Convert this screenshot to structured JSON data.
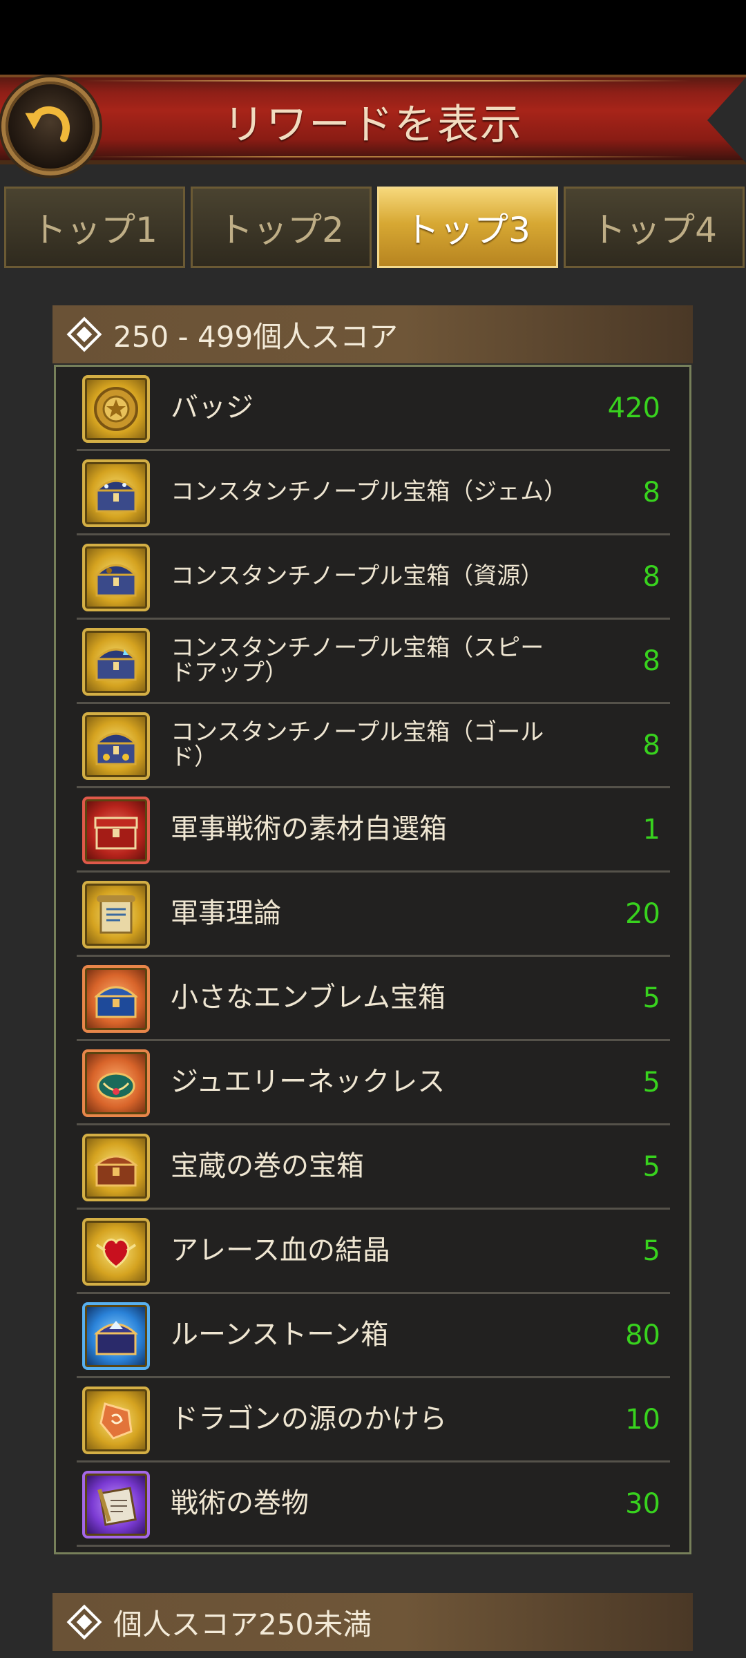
{
  "header": {
    "title": "リワードを表示"
  },
  "tabs": [
    {
      "label": "トップ1"
    },
    {
      "label": "トップ2"
    },
    {
      "label": "トップ3"
    },
    {
      "label": "トップ4"
    }
  ],
  "active_tab": "トップ3",
  "sections": [
    {
      "title": "250 - 499個人スコア",
      "items": [
        {
          "icon": "badge-icon",
          "name": "バッジ",
          "count": "420"
        },
        {
          "icon": "chest-icon",
          "name": "コンスタンチノープル宝箱（ジェム）",
          "count": "8"
        },
        {
          "icon": "chest-icon",
          "name": "コンスタンチノープル宝箱（資源）",
          "count": "8"
        },
        {
          "icon": "chest-icon",
          "name": "コンスタンチノープル宝箱（スピードアップ）",
          "count": "8"
        },
        {
          "icon": "chest-icon",
          "name": "コンスタンチノープル宝箱（ゴールド）",
          "count": "8"
        },
        {
          "icon": "red-chest-icon",
          "name": "軍事戦術の素材自選箱",
          "count": "1"
        },
        {
          "icon": "scroll-icon",
          "name": "軍事理論",
          "count": "20"
        },
        {
          "icon": "emblem-chest-icon",
          "name": "小さなエンブレム宝箱",
          "count": "5"
        },
        {
          "icon": "necklace-icon",
          "name": "ジュエリーネックレス",
          "count": "5"
        },
        {
          "icon": "treasure-chest-icon",
          "name": "宝蔵の巻の宝箱",
          "count": "5"
        },
        {
          "icon": "blood-crystal-icon",
          "name": "アレース血の結晶",
          "count": "5"
        },
        {
          "icon": "rune-chest-icon",
          "name": "ルーンストーン箱",
          "count": "80"
        },
        {
          "icon": "dragon-shard-icon",
          "name": "ドラゴンの源のかけら",
          "count": "10"
        },
        {
          "icon": "tactic-scroll-icon",
          "name": "戦術の巻物",
          "count": "30"
        }
      ]
    },
    {
      "title": "個人スコア250未満"
    }
  ],
  "colors": {
    "count_green": "#38d21e",
    "header_red": "#a72419",
    "tab_active_gold": "#d7a833"
  }
}
